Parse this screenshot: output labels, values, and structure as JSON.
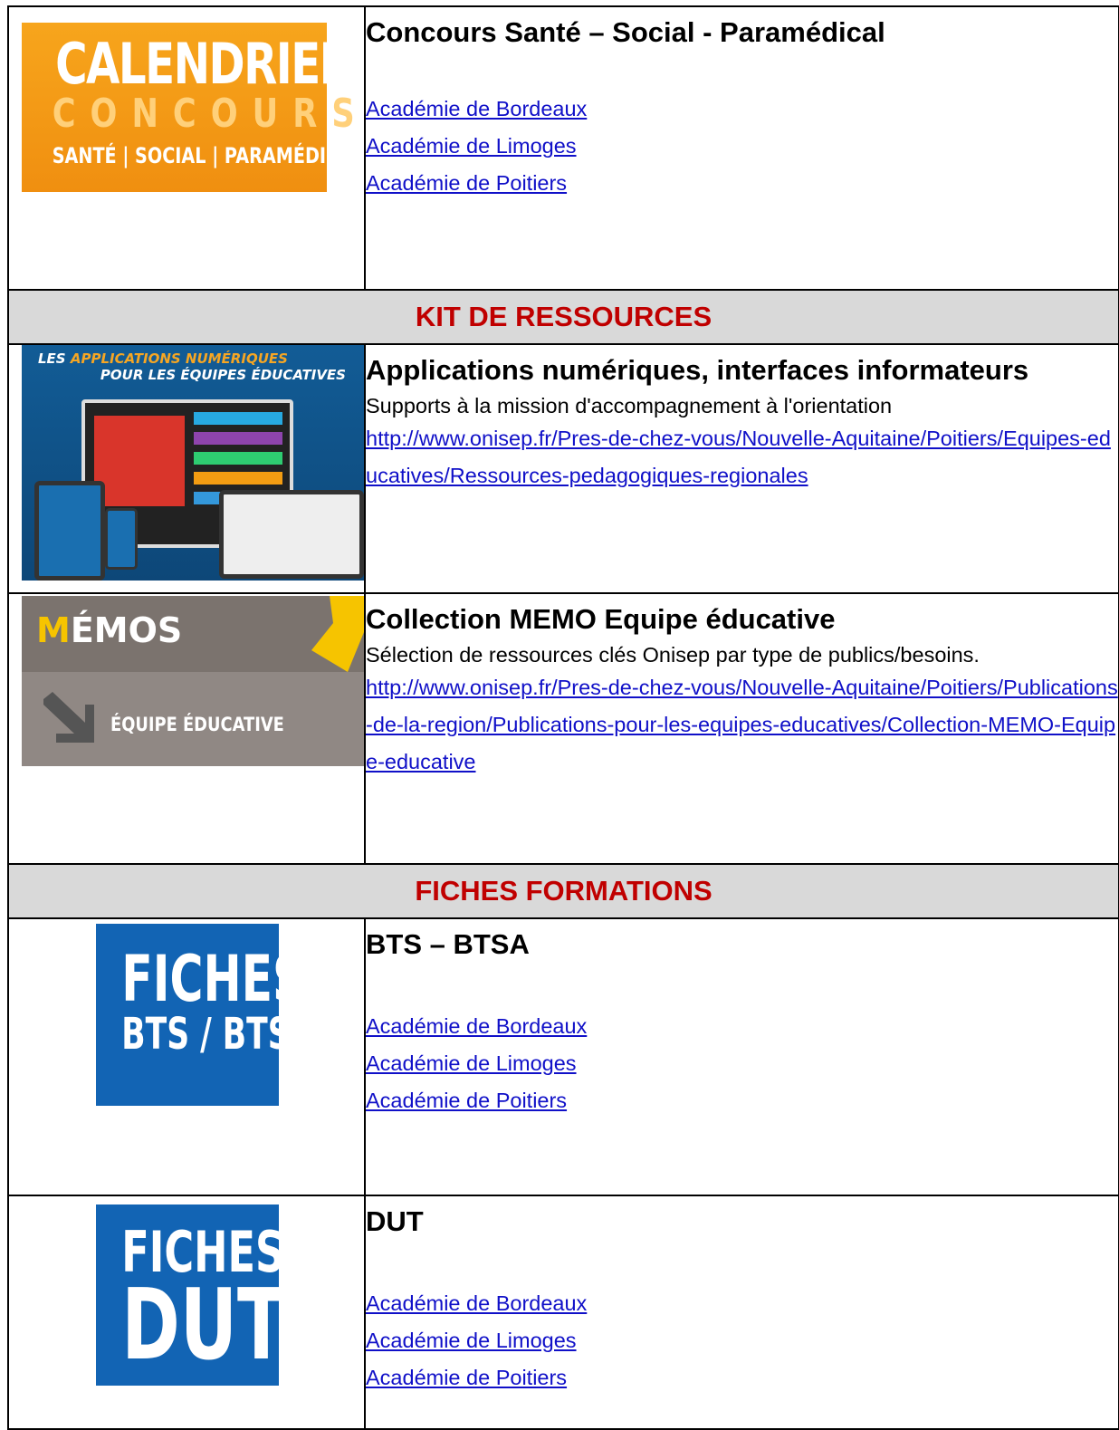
{
  "rows": {
    "concours": {
      "title": "Concours Santé – Social - Paramédical",
      "image_text": {
        "line1": "CALENDRIER",
        "line2": "CONCOURS",
        "line3": "SANTÉ | SOCIAL | PARAMÉDICAL"
      },
      "links": [
        "Académie de Bordeaux ",
        "Académie de Limoges",
        "Académie de Poitiers"
      ]
    },
    "kit_header": "KIT DE RESSOURCES",
    "applications": {
      "title": "Applications numériques, interfaces informateurs",
      "subtitle": "Supports à la mission d'accompagnement à l'orientation",
      "url": "http://www.onisep.fr/Pres-de-chez-vous/Nouvelle-Aquitaine/Poitiers/Equipes-educatives/Ressources-pedagogiques-regionales",
      "image_text": {
        "line1_a": "LES ",
        "line1_b": "APPLICATIONS NUMÉRIQUES",
        "line2": "POUR LES ÉQUIPES ÉDUCATIVES"
      }
    },
    "memo": {
      "title": "Collection MEMO Equipe éducative",
      "subtitle": "Sélection de ressources clés Onisep par type de publics/besoins.",
      "url": "http://www.onisep.fr/Pres-de-chez-vous/Nouvelle-Aquitaine/Poitiers/Publications-de-la-region/Publications-pour-les-equipes-educatives/Collection-MEMO-Equipe-educative",
      "image_text": {
        "m_first": "M",
        "m_rest": "ÉMOS",
        "sub": "ÉQUIPE ÉDUCATIVE"
      }
    },
    "fiches_header": "FICHES FORMATIONS",
    "bts": {
      "title": "BTS – BTSA",
      "image_text": {
        "line1": "FICHES",
        "line2": "BTS / BTSA"
      },
      "links": [
        "Académie de Bordeaux ",
        "Académie de Limoges",
        "Académie de Poitiers"
      ]
    },
    "dut": {
      "title": "DUT",
      "image_text": {
        "line1": "FICHES",
        "line2": "DUT"
      },
      "links": [
        "Académie de Bordeaux ",
        "Académie de Limoges",
        "Académie de Poitiers"
      ]
    }
  },
  "colors": {
    "header_bg": "#d9d9d9",
    "header_text": "#c00000",
    "link": "#1010c8"
  }
}
